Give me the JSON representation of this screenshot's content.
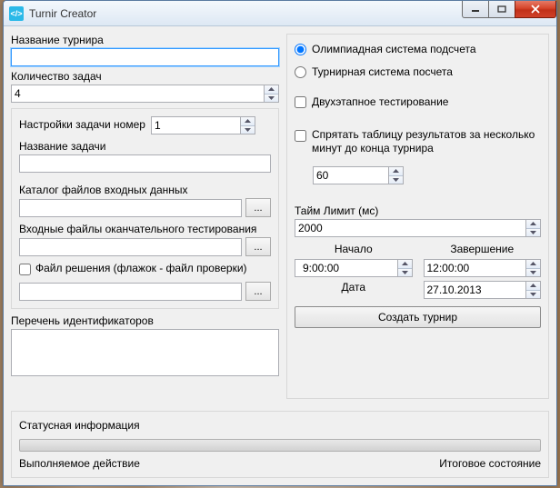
{
  "window": {
    "title": "Turnir Creator",
    "icon_text": "</>"
  },
  "left": {
    "tournament_name_label": "Название турнира",
    "tournament_name": "",
    "tasks_count_label": "Количество задач",
    "tasks_count": "4",
    "task_settings_label": "Настройки задачи номер",
    "task_number": "1",
    "task_name_label": "Название задачи",
    "task_name": "",
    "input_dir_label": "Каталог файлов входных данных",
    "input_dir": "",
    "final_files_label": "Входные файлы оканчательного тестирования",
    "final_files": "",
    "solution_checkbox_label": "Файл решения (флажок - файл проверки)",
    "solution_path": "",
    "ids_label": "Перечень идентификаторов",
    "browse_label": "..."
  },
  "right": {
    "scoring_olympiad": "Олимпиадная система подсчета",
    "scoring_tournament": "Турнирная система посчета",
    "two_stage": "Двухэтапное тестирование",
    "hide_table": "Спрятать таблицу результатов за несколько минут до конца турнира",
    "hide_minutes": "60",
    "time_limit_label": "Тайм Лимит (мс)",
    "time_limit": "2000",
    "start_label": "Начало",
    "end_label": "Завершение",
    "start_time": "9:00:00",
    "end_time": "12:00:00",
    "date_label": "Дата",
    "date": "27.10.2013",
    "create_button": "Создать турнир"
  },
  "status": {
    "title": "Статусная информация",
    "action_label": "Выполняемое действие",
    "final_label": "Итоговое состояние"
  }
}
